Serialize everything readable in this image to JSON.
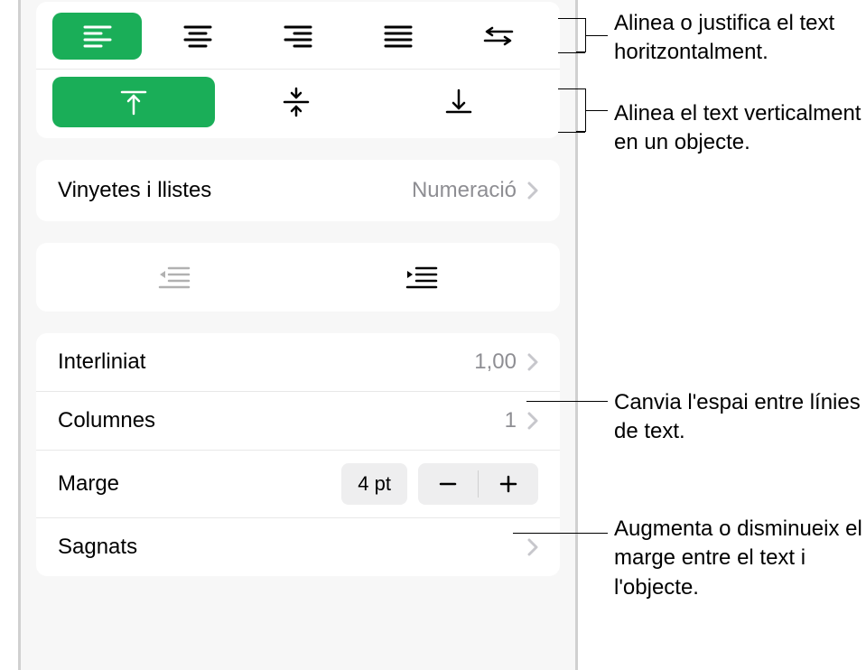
{
  "bullets": {
    "label": "Vinyetes i llistes",
    "value": "Numeració"
  },
  "lineSpacing": {
    "label": "Interliniat",
    "value": "1,00"
  },
  "columns": {
    "label": "Columnes",
    "value": "1"
  },
  "margin": {
    "label": "Marge",
    "value": "4 pt"
  },
  "indents": {
    "label": "Sagnats"
  },
  "callouts": {
    "halign": "Alinea o justifica el text horitzontalment.",
    "valign": "Alinea el text verticalment en un objecte.",
    "lineSpacing": "Canvia l'espai entre línies de text.",
    "margin": "Augmenta o disminueix el marge entre el text i l'objecte."
  }
}
